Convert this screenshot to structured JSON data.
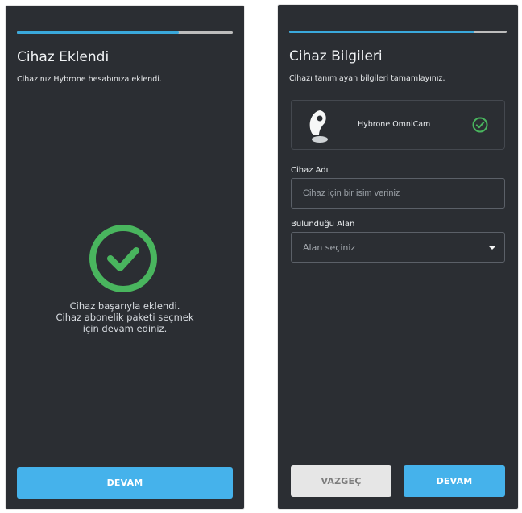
{
  "screen1": {
    "progress": 0.75,
    "title": "Cihaz Eklendi",
    "subtitle": "Cihazınız Hybrone hesabınıza eklendi.",
    "message_lines": [
      "Cihaz başarıyla eklendi.",
      "Cihaz abonelik paketi seçmek",
      "için devam ediniz."
    ],
    "continue_label": "DEVAM",
    "icons": {
      "success": "check-circle-icon"
    }
  },
  "screen2": {
    "progress": 0.85,
    "title": "Cihaz Bilgileri",
    "subtitle": "Cihazı tanımlayan bilgileri tamamlayınız.",
    "device": {
      "name": "Hybrone OmniCam",
      "image_icon": "camera-device-icon",
      "status_icon": "check-circle-icon"
    },
    "name_field": {
      "label": "Cihaz Adı",
      "placeholder": "Cihaz için bir isim veriniz"
    },
    "area_field": {
      "label": "Bulunduğu Alan",
      "placeholder": "Alan seçiniz",
      "icon": "chevron-down-icon"
    },
    "cancel_label": "VAZGEÇ",
    "continue_label": "DEVAM"
  },
  "colors": {
    "background": "#2b2e33",
    "accent": "#45b2eb",
    "success": "#49b55e"
  }
}
